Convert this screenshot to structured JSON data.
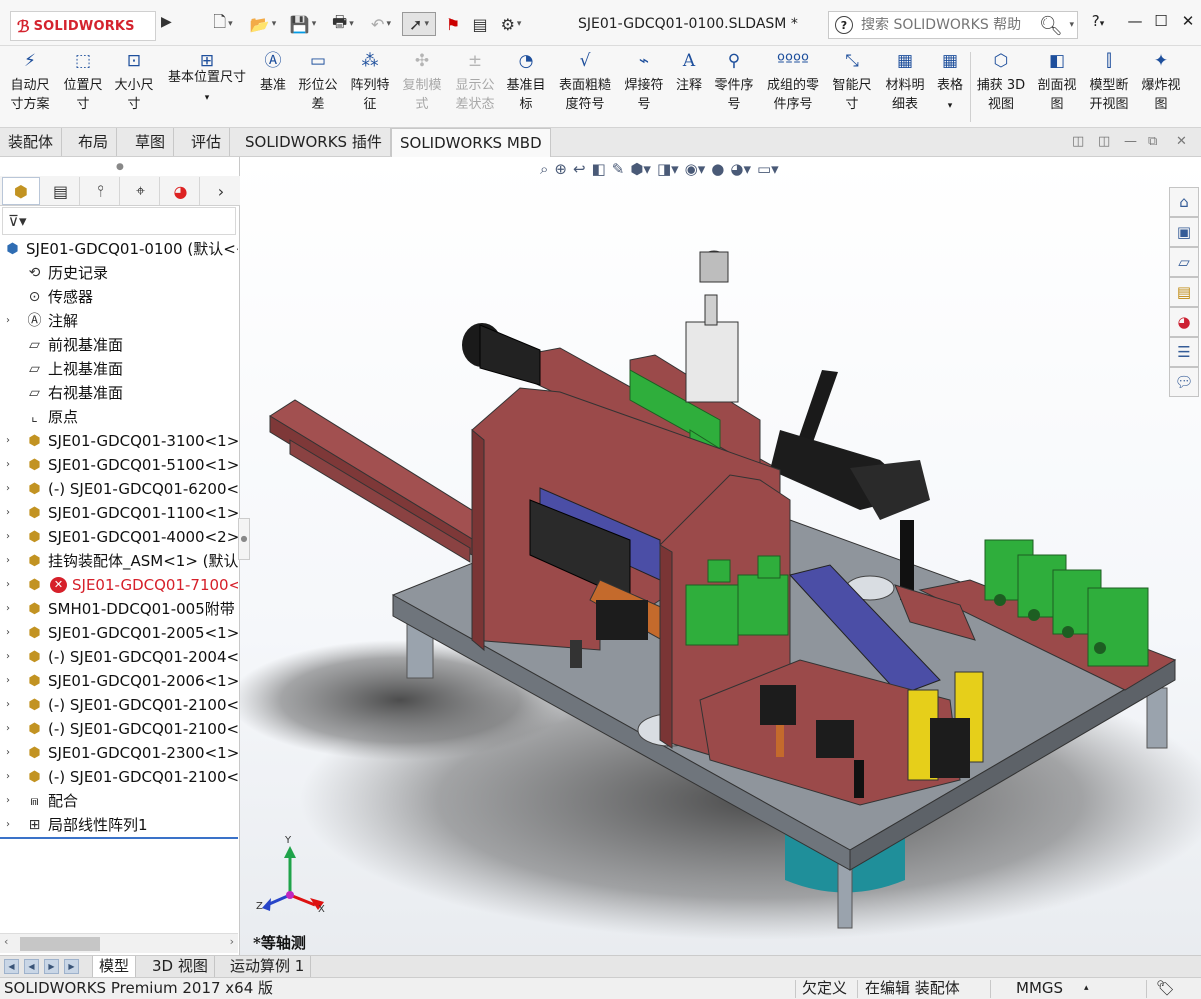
{
  "app": {
    "logo_text": "SOLIDWORKS",
    "document_title": "SJE01-GDCQ01-0100.SLDASM *",
    "search_placeholder": "搜索 SOLIDWORKS 帮助",
    "help_label": "?"
  },
  "ribbon": {
    "buttons": [
      {
        "label1": "自动尺",
        "label2": "寸方案",
        "icon": "auto-dimension-icon",
        "enabled": true
      },
      {
        "label1": "位置尺",
        "label2": "寸",
        "icon": "location-dimension-icon",
        "enabled": true
      },
      {
        "label1": "大小尺",
        "label2": "寸",
        "icon": "size-dimension-icon",
        "enabled": true
      },
      {
        "label1": "基本位置尺寸",
        "label2": "",
        "icon": "basic-location-dimension-icon",
        "enabled": true
      },
      {
        "label1": "基准",
        "label2": "",
        "icon": "datum-icon",
        "enabled": true
      },
      {
        "label1": "形位公",
        "label2": "差",
        "icon": "geometric-tolerance-icon",
        "enabled": true
      },
      {
        "label1": "阵列特",
        "label2": "征",
        "icon": "pattern-feature-icon",
        "enabled": true
      },
      {
        "label1": "复制模",
        "label2": "式",
        "icon": "copy-scheme-icon",
        "enabled": false
      },
      {
        "label1": "显示公",
        "label2": "差状态",
        "icon": "show-tolerance-status-icon",
        "enabled": false
      },
      {
        "label1": "基准目",
        "label2": "标",
        "icon": "datum-target-icon",
        "enabled": true
      },
      {
        "label1": "表面粗糙",
        "label2": "度符号",
        "icon": "surface-finish-icon",
        "enabled": true
      },
      {
        "label1": "焊接符",
        "label2": "号",
        "icon": "weld-symbol-icon",
        "enabled": true
      },
      {
        "label1": "注释",
        "label2": "",
        "icon": "note-icon",
        "enabled": true
      },
      {
        "label1": "零件序",
        "label2": "号",
        "icon": "balloon-icon",
        "enabled": true
      },
      {
        "label1": "成组的零",
        "label2": "件序号",
        "icon": "stacked-balloon-icon",
        "enabled": true
      },
      {
        "label1": "智能尺",
        "label2": "寸",
        "icon": "smart-dimension-icon",
        "enabled": true
      },
      {
        "label1": "材料明",
        "label2": "细表",
        "icon": "bill-of-materials-icon",
        "enabled": true
      },
      {
        "label1": "表格",
        "label2": "",
        "icon": "table-icon",
        "enabled": true
      },
      {
        "label1": "捕获 3D",
        "label2": "视图",
        "icon": "capture-3d-view-icon",
        "enabled": true
      },
      {
        "label1": "剖面视",
        "label2": "图",
        "icon": "section-view-icon",
        "enabled": true
      },
      {
        "label1": "模型断",
        "label2": "开视图",
        "icon": "model-break-view-icon",
        "enabled": true
      },
      {
        "label1": "爆炸视",
        "label2": "图",
        "icon": "exploded-view-icon",
        "enabled": true
      }
    ]
  },
  "command_tabs": [
    "装配体",
    "布局",
    "草图",
    "评估",
    "SOLIDWORKS 插件",
    "SOLIDWORKS MBD"
  ],
  "active_command_tab": "SOLIDWORKS MBD",
  "feature_tree": {
    "root": "SJE01-GDCQ01-0100  (默认<<",
    "items": [
      {
        "label": "历史记录",
        "icon": "history-icon",
        "expandable": false,
        "kind": "plain"
      },
      {
        "label": "传感器",
        "icon": "sensor-icon",
        "expandable": false,
        "kind": "plain"
      },
      {
        "label": "注解",
        "icon": "annotation-icon",
        "expandable": true,
        "kind": "plain"
      },
      {
        "label": "前视基准面",
        "icon": "plane-icon",
        "expandable": false,
        "kind": "plain"
      },
      {
        "label": "上视基准面",
        "icon": "plane-icon",
        "expandable": false,
        "kind": "plain"
      },
      {
        "label": "右视基准面",
        "icon": "plane-icon",
        "expandable": false,
        "kind": "plain"
      },
      {
        "label": "原点",
        "icon": "origin-icon",
        "expandable": false,
        "kind": "plain"
      },
      {
        "label": "SJE01-GDCQ01-3100<1> (",
        "icon": "assembly-icon",
        "expandable": true,
        "kind": "asm"
      },
      {
        "label": "SJE01-GDCQ01-5100<1> (",
        "icon": "assembly-icon",
        "expandable": true,
        "kind": "asm"
      },
      {
        "label": "(-) SJE01-GDCQ01-6200<1",
        "icon": "assembly-icon",
        "expandable": true,
        "kind": "asm-float"
      },
      {
        "label": "SJE01-GDCQ01-1100<1> (",
        "icon": "assembly-icon",
        "expandable": true,
        "kind": "asm"
      },
      {
        "label": "SJE01-GDCQ01-4000<2> (",
        "icon": "assembly-icon",
        "expandable": true,
        "kind": "asm"
      },
      {
        "label": "挂钩装配体_ASM<1> (默认",
        "icon": "assembly-icon",
        "expandable": true,
        "kind": "asm"
      },
      {
        "label": "SJE01-GDCQ01-7100<1",
        "icon": "assembly-icon",
        "expandable": true,
        "kind": "error"
      },
      {
        "label": "SMH01-DDCQ01-005附带",
        "icon": "assembly-icon",
        "expandable": true,
        "kind": "asm"
      },
      {
        "label": "SJE01-GDCQ01-2005<1> (",
        "icon": "assembly-icon",
        "expandable": true,
        "kind": "asm"
      },
      {
        "label": "(-) SJE01-GDCQ01-2004<1",
        "icon": "assembly-icon",
        "expandable": true,
        "kind": "asm-float"
      },
      {
        "label": "SJE01-GDCQ01-2006<1> (",
        "icon": "assembly-icon",
        "expandable": true,
        "kind": "asm"
      },
      {
        "label": "(-) SJE01-GDCQ01-2100<1",
        "icon": "assembly-icon",
        "expandable": true,
        "kind": "asm-float"
      },
      {
        "label": "(-) SJE01-GDCQ01-2100<2",
        "icon": "assembly-icon",
        "expandable": true,
        "kind": "asm-float"
      },
      {
        "label": "SJE01-GDCQ01-2300<1> (",
        "icon": "assembly-icon",
        "expandable": true,
        "kind": "asm"
      },
      {
        "label": "(-) SJE01-GDCQ01-2100<3",
        "icon": "assembly-icon",
        "expandable": true,
        "kind": "asm-float"
      },
      {
        "label": "配合",
        "icon": "mates-icon",
        "expandable": true,
        "kind": "plain"
      },
      {
        "label": "局部线性阵列1",
        "icon": "linear-pattern-icon",
        "expandable": true,
        "kind": "plain"
      }
    ]
  },
  "viewport": {
    "view_name": "*等轴测",
    "triad_labels": {
      "x": "X",
      "y": "Y",
      "z": "Z"
    }
  },
  "bottom_tabs": [
    "模型",
    "3D 视图",
    "运动算例 1"
  ],
  "active_bottom_tab": "模型",
  "status": {
    "product": "SOLIDWORKS Premium 2017 x64 版",
    "definition": "欠定义",
    "mode": "在编辑 装配体",
    "units": "MMGS"
  },
  "colors": {
    "plate": "#8f959c",
    "frame": "#9b4a4a",
    "valve": "#2fae3c",
    "slide": "#4b4ea6",
    "yellow": "#e6cf1a",
    "base_cyan": "#1f8f9a",
    "error_red": "#d6202a"
  }
}
